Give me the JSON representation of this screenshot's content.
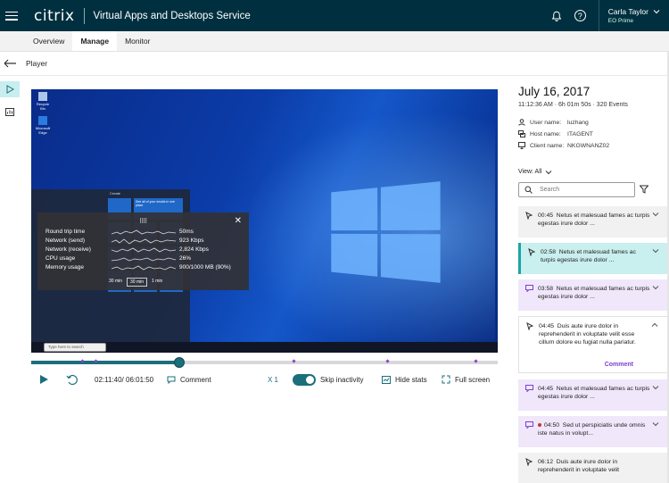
{
  "app": {
    "logo": "citrix",
    "service": "Virtual Apps and Desktops Service",
    "user_name": "Carla Taylor",
    "user_org": "EO Prime"
  },
  "tabs": [
    {
      "label": "Overview"
    },
    {
      "label": "Manage"
    },
    {
      "label": "Monitor"
    }
  ],
  "player": {
    "title": "Player"
  },
  "stats": {
    "rows": [
      {
        "label": "Round trip time",
        "value": "50ms"
      },
      {
        "label": "Network (send)",
        "value": "923 Kbps"
      },
      {
        "label": "Network (receive)",
        "value": "2,824 Kbps"
      },
      {
        "label": "CPU usage",
        "value": "26%"
      },
      {
        "label": "Memory usage",
        "value": "900/1000 MB (90%)"
      }
    ],
    "ranges": [
      "30 min",
      "30 min",
      "1 min"
    ]
  },
  "desktop": {
    "icons": [
      "Recycle Bin",
      "Microsoft Edge"
    ],
    "taskbar_search": "Type here to search",
    "start_col_label": "Create",
    "start_tile_hint": "See all of your emails in one place"
  },
  "timeline": {
    "progress": 0.317
  },
  "controls": {
    "time": "02:11:40/ 06:01:50",
    "comment": "Comment",
    "speed": "X 1",
    "skip": "Skip inactivity",
    "hide_stats": "Hide stats",
    "full_screen": "Full screen"
  },
  "session": {
    "date": "July 16, 2017",
    "meta": "11:12:36 AM  ·  6h 01m 50s  ·  320 Events",
    "user_label": "User name:",
    "user_value": "luzhang",
    "host_label": "Host name:",
    "host_value": "ITAGENT",
    "client_label": "Client name:",
    "client_value": "NKGWNANZ02",
    "view": "View: All",
    "search_placeholder": "Search"
  },
  "events": [
    {
      "time": "00:45",
      "text": "Netus et malesuad fames ac turpis egestas irure dolor ..."
    },
    {
      "time": "02:58",
      "text": "Netus et malesuad fames ac turpis egestas irure dolor ..."
    },
    {
      "time": "03:58",
      "text": "Netus et malesuad fames ac turpis egestas irure dolor ..."
    },
    {
      "time": "04:45",
      "text": "Duis aute irure dolor in reprehenderit in voluptate velit esse cillum dolore eu fugiat nulla pariatur.",
      "action": "Comment"
    },
    {
      "time": "04:45",
      "text": "Netus et malesuad fames ac turpis egestas irure dolor ..."
    },
    {
      "time": "04:50",
      "text": "Sed ut perspiciatis unde omnis iste natus in volupt..."
    },
    {
      "time": "06:12",
      "text": "Duis aute irure dolor in reprehenderit in voluptate velit"
    }
  ],
  "colors": {
    "topbar": "#00303f",
    "accent": "#1a6f7a",
    "event_purple": "#f0e7fb",
    "event_teal": "#c9efef"
  }
}
